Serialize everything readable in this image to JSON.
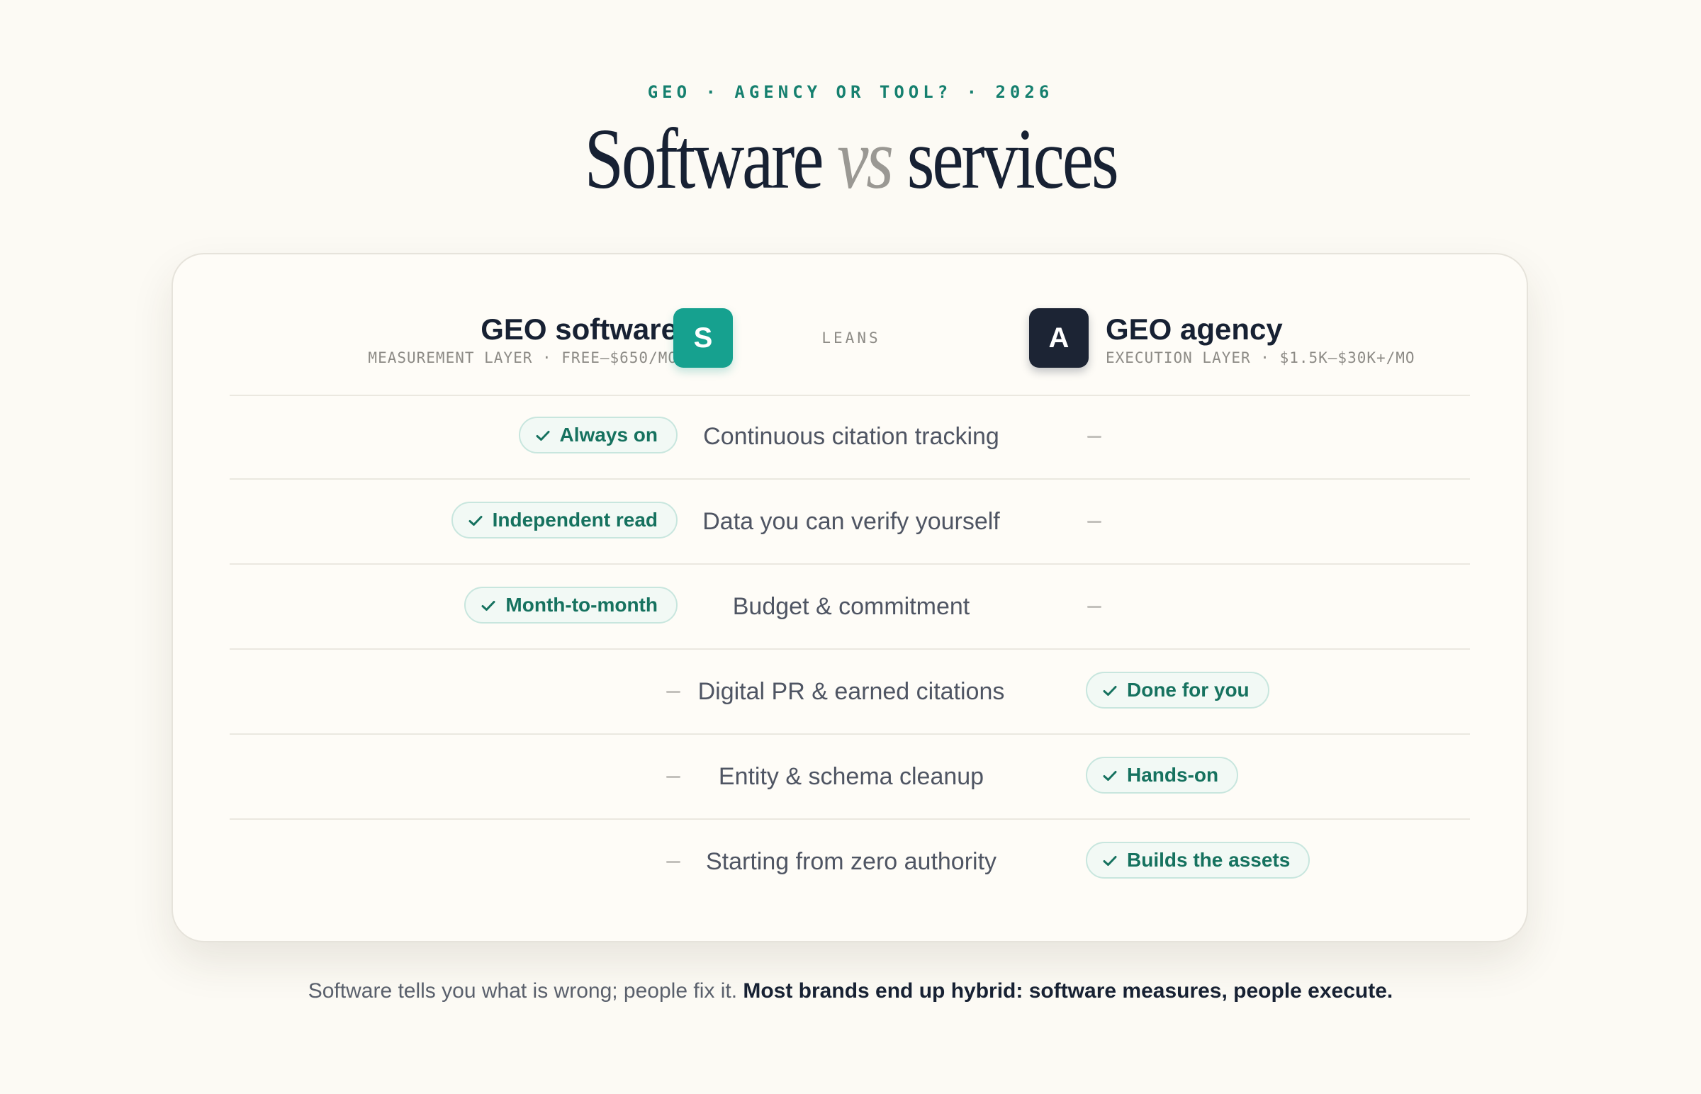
{
  "eyebrow": "GEO · AGENCY OR TOOL? · 2026",
  "title": {
    "part1": "Software",
    "vs": "vs",
    "part2": "services"
  },
  "software": {
    "name": "GEO software",
    "sub": "MEASUREMENT LAYER · FREE–$650/MO",
    "logo_letter": "S",
    "accent": "#16a18f"
  },
  "agency": {
    "name": "GEO agency",
    "sub": "EXECUTION LAYER · $1.5K–$30K+/MO",
    "logo_letter": "A",
    "accent": "#1c2434"
  },
  "center_header": "LEANS",
  "rows": [
    {
      "criterion": "Continuous citation tracking",
      "lean": "software",
      "badge": "Always on"
    },
    {
      "criterion": "Data you can verify yourself",
      "lean": "software",
      "badge": "Independent read"
    },
    {
      "criterion": "Budget & commitment",
      "lean": "software",
      "badge": "Month-to-month"
    },
    {
      "criterion": "Digital PR & earned citations",
      "lean": "agency",
      "badge": "Done for you"
    },
    {
      "criterion": "Entity & schema cleanup",
      "lean": "agency",
      "badge": "Hands-on"
    },
    {
      "criterion": "Starting from zero authority",
      "lean": "agency",
      "badge": "Builds the assets"
    }
  ],
  "footnote": {
    "plain": "Software tells you what is wrong; people fix it. ",
    "bold": "Most brands end up hybrid: software measures, people execute."
  },
  "colors": {
    "background": "#fcfaf4",
    "badge_text": "#16725f",
    "ink": "#172133"
  }
}
